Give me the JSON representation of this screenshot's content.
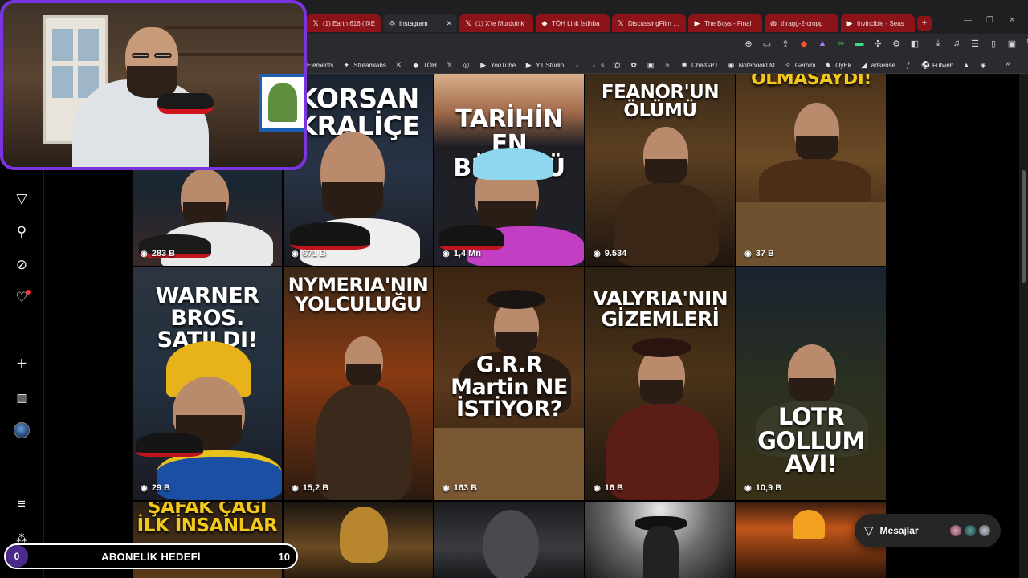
{
  "browser": {
    "tabs": [
      {
        "label": "(1) Earth 616 (@E",
        "icon": "x-logo-icon",
        "glyph": "𝕏",
        "active": false
      },
      {
        "label": "Instagram",
        "icon": "instagram-icon",
        "glyph": "◎",
        "active": true
      },
      {
        "label": "(1) X'te Murdoink",
        "icon": "x-logo-icon",
        "glyph": "𝕏",
        "active": false
      },
      {
        "label": "TÖH Link İstihba",
        "icon": "toh-icon",
        "glyph": "◆",
        "active": false
      },
      {
        "label": "DiscussingFilm (@",
        "icon": "x-logo-icon",
        "glyph": "𝕏",
        "active": false
      },
      {
        "label": "The Boys - Final",
        "icon": "youtube-icon",
        "glyph": "▶",
        "active": false
      },
      {
        "label": "thragg-2-cropp",
        "icon": "globe-icon",
        "glyph": "◍",
        "active": false
      },
      {
        "label": "Invincible - Seas",
        "icon": "youtube-icon",
        "glyph": "▶",
        "active": false
      }
    ],
    "new_tab": "+",
    "bookmarks": [
      {
        "label": "Elements",
        "icon": "",
        "glyph": ""
      },
      {
        "label": "Streamlabs",
        "icon": "streamlabs-icon",
        "glyph": "✦"
      },
      {
        "label": "",
        "icon": "kick-icon",
        "glyph": "K"
      },
      {
        "label": "TÖH",
        "icon": "toh-icon",
        "glyph": "◆"
      },
      {
        "label": "",
        "icon": "x-logo-icon",
        "glyph": "𝕏"
      },
      {
        "label": "",
        "icon": "instagram-icon",
        "glyph": "◎"
      },
      {
        "label": "YouTube",
        "icon": "youtube-icon",
        "glyph": "▶"
      },
      {
        "label": "YT Studio",
        "icon": "youtube-studio-icon",
        "glyph": "▶"
      },
      {
        "label": "",
        "icon": "tiktok-icon",
        "glyph": "♪"
      },
      {
        "label": "s",
        "icon": "tiktok-icon",
        "glyph": "♪"
      },
      {
        "label": "",
        "icon": "threads-icon",
        "glyph": "@"
      },
      {
        "label": "",
        "icon": "app-icon",
        "glyph": "✿"
      },
      {
        "label": "",
        "icon": "bookmark-app-icon",
        "glyph": "▣"
      },
      {
        "label": "",
        "icon": "link-icon",
        "glyph": "≈"
      },
      {
        "label": "ChatGPT",
        "icon": "chatgpt-icon",
        "glyph": "✺"
      },
      {
        "label": "NotebookLM",
        "icon": "notebooklm-icon",
        "glyph": "◉"
      },
      {
        "label": "Gemini",
        "icon": "gemini-icon",
        "glyph": "✧"
      },
      {
        "label": "OyEk",
        "icon": "oyek-icon",
        "glyph": "♞"
      },
      {
        "label": "adsense",
        "icon": "adsense-icon",
        "glyph": "◢"
      },
      {
        "label": "",
        "icon": "app-icon",
        "glyph": "ƒ"
      },
      {
        "label": "Futweb",
        "icon": "futweb-icon",
        "glyph": "⚽"
      },
      {
        "label": "",
        "icon": "pdf-icon",
        "glyph": "▲"
      },
      {
        "label": "",
        "icon": "app-icon",
        "glyph": "◈"
      }
    ]
  },
  "sidebar": {
    "items": [
      {
        "name": "home-icon",
        "glyph": "⌂"
      },
      {
        "name": "reels-icon",
        "glyph": "▷"
      },
      {
        "name": "messages-icon",
        "glyph": "✈"
      },
      {
        "name": "search-icon",
        "glyph": "⚲"
      },
      {
        "name": "explore-icon",
        "glyph": "✪"
      },
      {
        "name": "notifications-icon",
        "glyph": "♡"
      },
      {
        "name": "create-icon",
        "glyph": "+"
      },
      {
        "name": "dashboard-icon",
        "glyph": "▥"
      },
      {
        "name": "profile-avatar",
        "glyph": ""
      },
      {
        "name": "menu-icon",
        "glyph": "≡"
      },
      {
        "name": "more-icon",
        "glyph": "⁂"
      }
    ]
  },
  "grid": {
    "posts": [
      {
        "title": "",
        "views": "283 B"
      },
      {
        "title": "KORSAN KRALİÇE",
        "views": "671 B"
      },
      {
        "title": "TARİHİN EN BÜYÜĞÜ",
        "views": "1,4 Mn"
      },
      {
        "title": "FEANOR'UN ÖLÜMÜ",
        "views": "9.534"
      },
      {
        "title": "OLMASAYDI!",
        "views": "37 B"
      },
      {
        "title": "WARNER BROS. SATILDI!",
        "views": "29 B"
      },
      {
        "title": "NYMERIA'NIN YOLCULUĞU",
        "views": "15,2 B"
      },
      {
        "title": "G.R.R Martin NE İSTİYOR?",
        "views": "163 B"
      },
      {
        "title": "VALYRIA'NIN GİZEMLERİ",
        "views": "16 B"
      },
      {
        "title": "LOTR GOLLUM AVI!",
        "views": "10,9 B"
      },
      {
        "title": "ŞAFAK ÇAĞI İLK İNSANLAR",
        "views": ""
      },
      {
        "title": "",
        "views": ""
      },
      {
        "title": "",
        "views": ""
      },
      {
        "title": "",
        "views": ""
      },
      {
        "title": "",
        "views": ""
      }
    ]
  },
  "messages": {
    "label": "Mesajlar"
  },
  "goal": {
    "current": "0",
    "label": "ABONELİK HEDEFİ",
    "target": "10"
  },
  "colors": {
    "accent": "#7a34e0",
    "tab_bg": "#8c1318",
    "notif": "#ff3040"
  }
}
